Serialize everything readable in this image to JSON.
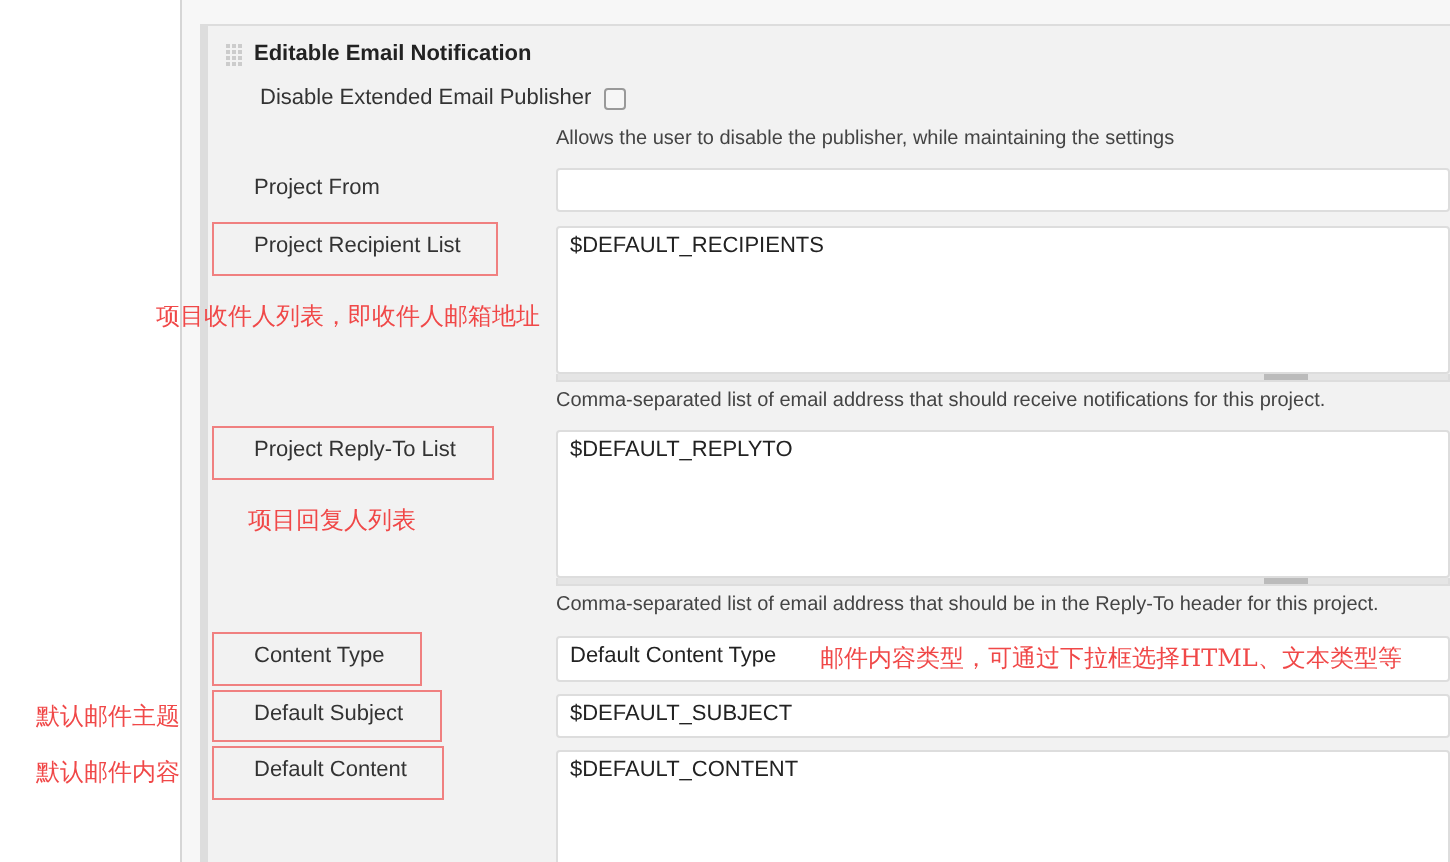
{
  "section": {
    "title": "Editable Email Notification"
  },
  "fields": [
    {
      "kind": "checkbox",
      "label": "Disable Extended Email Publisher",
      "checked": false,
      "help": "Allows the user to disable the publisher, while maintaining the settings"
    },
    {
      "kind": "text",
      "label": "Project From"
    },
    {
      "kind": "textarea",
      "label": "Project Recipient List",
      "value": "$DEFAULT_RECIPIENTS",
      "help": "Comma-separated list of email address that should receive notifications for this project.",
      "annotated": true,
      "note": "项目收件人列表，即收件人邮箱地址"
    },
    {
      "kind": "textarea",
      "label": "Project Reply-To List",
      "value": "$DEFAULT_REPLYTO",
      "help": "Comma-separated list of email address that should be in the Reply-To header for this project.",
      "annotated": true,
      "note": "项目回复人列表"
    },
    {
      "kind": "select",
      "label": "Content Type",
      "value": "Default Content Type",
      "annotated": true,
      "note": "邮件内容类型，可通过下拉框选择HTML、文本类型等"
    },
    {
      "kind": "text",
      "label": "Default Subject",
      "value": "$DEFAULT_SUBJECT",
      "annotated": true,
      "note": "默认邮件主题"
    },
    {
      "kind": "textarea",
      "label": "Default Content",
      "value": "$DEFAULT_CONTENT",
      "annotated": true,
      "note": "默认邮件内容"
    }
  ]
}
